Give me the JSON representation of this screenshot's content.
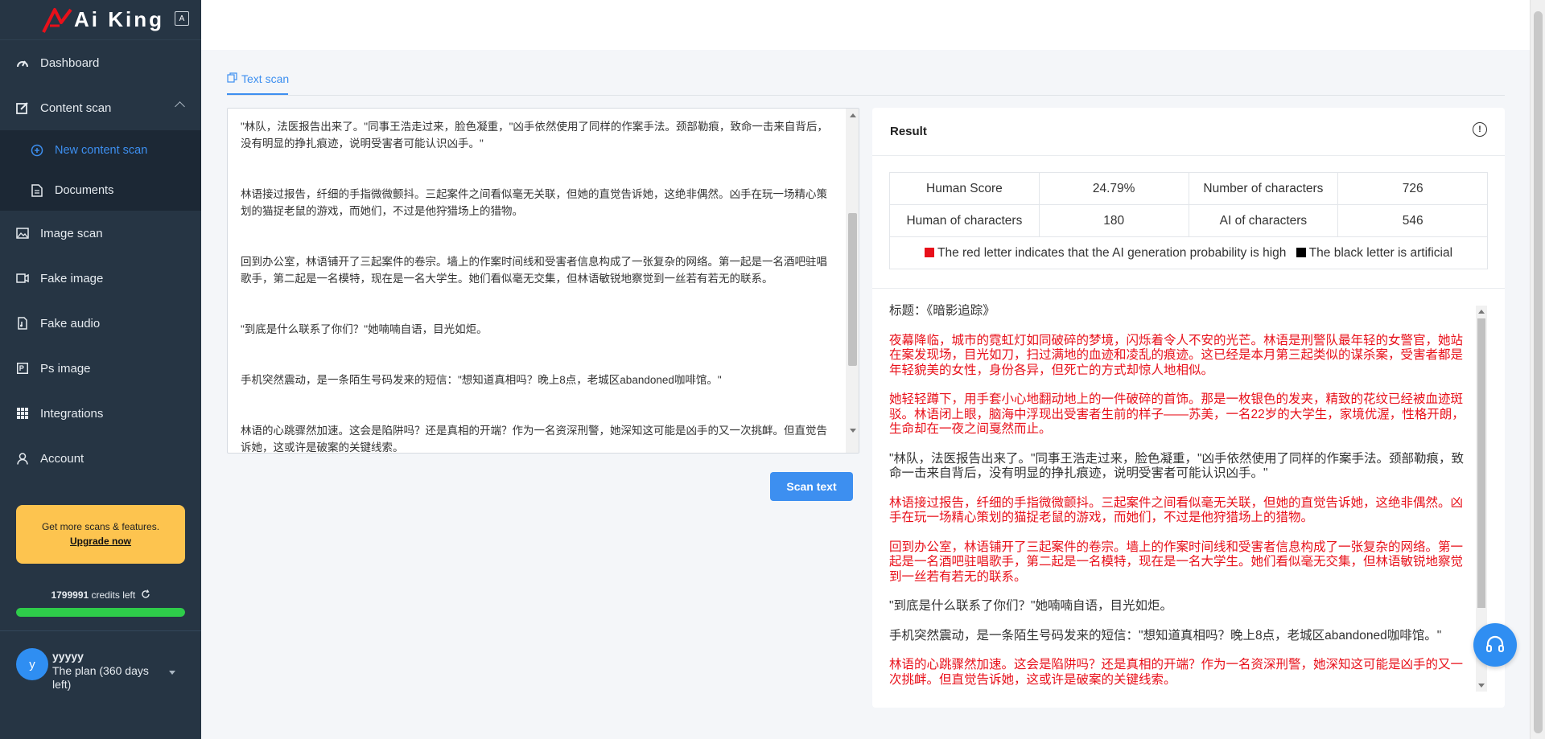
{
  "brand": {
    "name": "Ai King",
    "lang_toggle": "A"
  },
  "nav": {
    "dashboard": "Dashboard",
    "content_scan": "Content scan",
    "new_content_scan": "New content scan",
    "documents": "Documents",
    "image_scan": "Image scan",
    "fake_image": "Fake image",
    "fake_audio": "Fake audio",
    "ps_image": "Ps image",
    "integrations": "Integrations",
    "account": "Account"
  },
  "upgrade": {
    "text": "Get more scans & features.",
    "link": "Upgrade now"
  },
  "credits": {
    "amount": "1799991",
    "suffix": "credits left",
    "fraction": 1.0
  },
  "user": {
    "initial": "y",
    "name": "yyyyy",
    "plan": "The plan (360 days left)"
  },
  "tab": {
    "label": "Text scan"
  },
  "input": {
    "paragraphs": [
      "\"林队，法医报告出来了。\"同事王浩走过来，脸色凝重，\"凶手依然使用了同样的作案手法。颈部勒痕，致命一击来自背后，没有明显的挣扎痕迹，说明受害者可能认识凶手。\"",
      "林语接过报告，纤细的手指微微颤抖。三起案件之间看似毫无关联，但她的直觉告诉她，这绝非偶然。凶手在玩一场精心策划的猫捉老鼠的游戏，而她们，不过是他狩猎场上的猎物。",
      "回到办公室，林语铺开了三起案件的卷宗。墙上的作案时间线和受害者信息构成了一张复杂的网络。第一起是一名酒吧驻唱歌手，第二起是一名模特，现在是一名大学生。她们看似毫无交集，但林语敏锐地察觉到一丝若有若无的联系。",
      "\"到底是什么联系了你们？\"她喃喃自语，目光如炬。",
      "手机突然震动，是一条陌生号码发来的短信：\"想知道真相吗？晚上8点，老城区abandoned咖啡馆。\"",
      "林语的心跳骤然加速。这会是陷阱吗？还是真相的开端？作为一名资深刑警，她深知这可能是凶手的又一次挑衅。但直觉告诉她，这或许是破案的关键线索。"
    ]
  },
  "scan_button": "Scan text",
  "result": {
    "title": "Result",
    "info": "!",
    "human_score_label": "Human Score",
    "human_score": "24.79%",
    "num_chars_label": "Number of characters",
    "num_chars": "726",
    "human_chars_label": "Human of characters",
    "human_chars": "180",
    "ai_chars_label": "AI of characters",
    "ai_chars": "546",
    "legend_red": "The red letter indicates that the AI generation probability is high",
    "legend_black": "The black letter is artificial",
    "red_color": "#e8101a",
    "black_color": "#000000",
    "paragraphs": [
      {
        "text": "标题：《暗影追踪》",
        "ai": false
      },
      {
        "text": "夜幕降临，城市的霓虹灯如同破碎的梦境，闪烁着令人不安的光芒。林语是刑警队最年轻的女警官，她站在案发现场，目光如刀，扫过满地的血迹和凌乱的痕迹。这已经是本月第三起类似的谋杀案，受害者都是年轻貌美的女性，身份各异，但死亡的方式却惊人地相似。",
        "ai": true
      },
      {
        "text": "她轻轻蹲下，用手套小心地翻动地上的一件破碎的首饰。那是一枚银色的发夹，精致的花纹已经被血迹斑驳。林语闭上眼，脑海中浮现出受害者生前的样子——苏美，一名22岁的大学生，家境优渥，性格开朗，生命却在一夜之间戛然而止。",
        "ai": true
      },
      {
        "text": "\"林队，法医报告出来了。\"同事王浩走过来，脸色凝重，\"凶手依然使用了同样的作案手法。颈部勒痕，致命一击来自背后，没有明显的挣扎痕迹，说明受害者可能认识凶手。\"",
        "ai": false
      },
      {
        "text": "林语接过报告，纤细的手指微微颤抖。三起案件之间看似毫无关联，但她的直觉告诉她，这绝非偶然。凶手在玩一场精心策划的猫捉老鼠的游戏，而她们，不过是他狩猎场上的猎物。",
        "ai": true
      },
      {
        "text": "回到办公室，林语铺开了三起案件的卷宗。墙上的作案时间线和受害者信息构成了一张复杂的网络。第一起是一名酒吧驻唱歌手，第二起是一名模特，现在是一名大学生。她们看似毫无交集，但林语敏锐地察觉到一丝若有若无的联系。",
        "ai": true
      },
      {
        "text": "\"到底是什么联系了你们？\"她喃喃自语，目光如炬。",
        "ai": false
      },
      {
        "text": "手机突然震动，是一条陌生号码发来的短信：\"想知道真相吗？晚上8点，老城区abandoned咖啡馆。\"",
        "ai": false
      },
      {
        "text": "林语的心跳骤然加速。这会是陷阱吗？还是真相的开端？作为一名资深刑警，她深知这可能是凶手的又一次挑衅。但直觉告诉她，这或许是破案的关键线索。",
        "ai": true
      }
    ]
  },
  "icons": {
    "dashboard": "gauge-icon",
    "content_scan": "edit-icon",
    "new_content_scan": "plus-circle-icon",
    "documents": "document-icon",
    "image_scan": "image-icon",
    "fake_image": "video-icon",
    "fake_audio": "audio-file-icon",
    "ps_image": "ps-icon",
    "integrations": "grid-icon",
    "account": "user-icon",
    "refresh": "refresh-icon",
    "support": "headset-icon",
    "tab": "copy-icon"
  }
}
